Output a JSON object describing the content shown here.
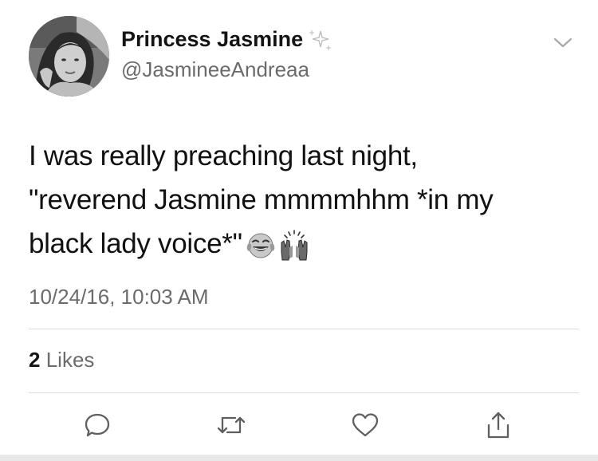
{
  "user": {
    "display_name": "Princess Jasmine",
    "handle": "@JasmineeAndreaa",
    "name_emoji": "sparkles-icon",
    "avatar": "profile-photo"
  },
  "tweet": {
    "lines": [
      "I was really preaching last night,",
      "\"reverend Jasmine mmmmhhm *in my",
      "black lady voice*\""
    ],
    "emojis": [
      "tears-of-joy-emoji",
      "raised-hands-emoji"
    ],
    "timestamp": "10/24/16, 10:03 AM"
  },
  "stats": {
    "likes_count": "2",
    "likes_label": "Likes"
  },
  "actions": [
    {
      "name": "reply",
      "icon": "reply-icon"
    },
    {
      "name": "retweet",
      "icon": "retweet-icon"
    },
    {
      "name": "like",
      "icon": "heart-icon"
    },
    {
      "name": "share",
      "icon": "share-icon"
    }
  ],
  "colors": {
    "text": "#111111",
    "secondary_text": "#6b6b6b",
    "divider": "#dcdcdc",
    "icon": "#5f5f5f"
  }
}
